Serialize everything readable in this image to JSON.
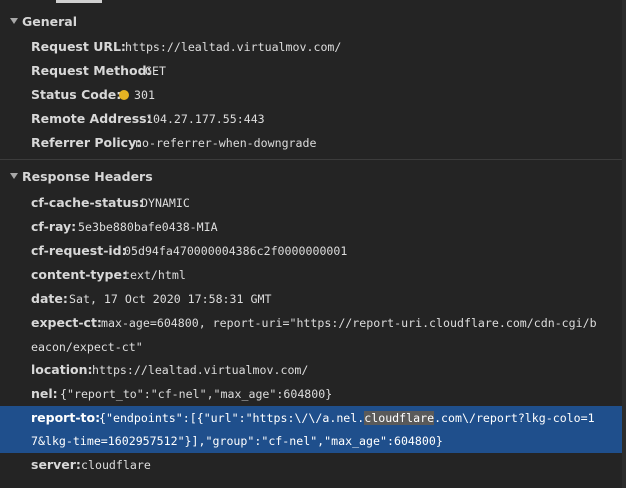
{
  "general": {
    "title": "General",
    "request_url_key": "Request URL:",
    "request_url_value": "https://lealtad.virtualmov.com/",
    "request_method_key": "Request Method:",
    "request_method_value": "GET",
    "status_code_key": "Status Code:",
    "status_code_value": "301",
    "remote_address_key": "Remote Address:",
    "remote_address_value": "104.27.177.55:443",
    "referrer_policy_key": "Referrer Policy:",
    "referrer_policy_value": "no-referrer-when-downgrade"
  },
  "response_headers": {
    "title": "Response Headers",
    "cf_cache_status_key": "cf-cache-status:",
    "cf_cache_status_value": "DYNAMIC",
    "cf_ray_key": "cf-ray:",
    "cf_ray_value": "5e3be880bafe0438-MIA",
    "cf_request_id_key": "cf-request-id:",
    "cf_request_id_value": "05d94fa470000004386c2f0000000001",
    "content_type_key": "content-type:",
    "content_type_value": "text/html",
    "date_key": "date:",
    "date_value": "Sat, 17 Oct 2020 17:58:31 GMT",
    "expect_ct_key": "expect-ct:",
    "expect_ct_value_line1": "max-age=604800, report-uri=\"https://report-uri.cloudflare.com/cdn-cgi/b",
    "expect_ct_value_line2": "eacon/expect-ct\"",
    "location_key": "location:",
    "location_value": "https://lealtad.virtualmov.com/",
    "nel_key": "nel:",
    "nel_value": "{\"report_to\":\"cf-nel\",\"max_age\":604800}",
    "report_to_key": "report-to:",
    "report_to_line1_a": "{\"endpoints\":[{\"url\":\"https:\\/\\/a.nel.",
    "report_to_line1_hl": "cloudflare",
    "report_to_line1_b": ".com\\/report?lkg-colo=1",
    "report_to_line2": "7&lkg-time=1602957512\"}],\"group\":\"cf-nel\",\"max_age\":604800}",
    "server_key": "server:",
    "server_value": "cloudflare"
  },
  "colors": {
    "background": "#242424",
    "selected_row": "#1f4f8c",
    "status_dot": "#e6b323",
    "search_highlight": "#5a5a5a"
  }
}
